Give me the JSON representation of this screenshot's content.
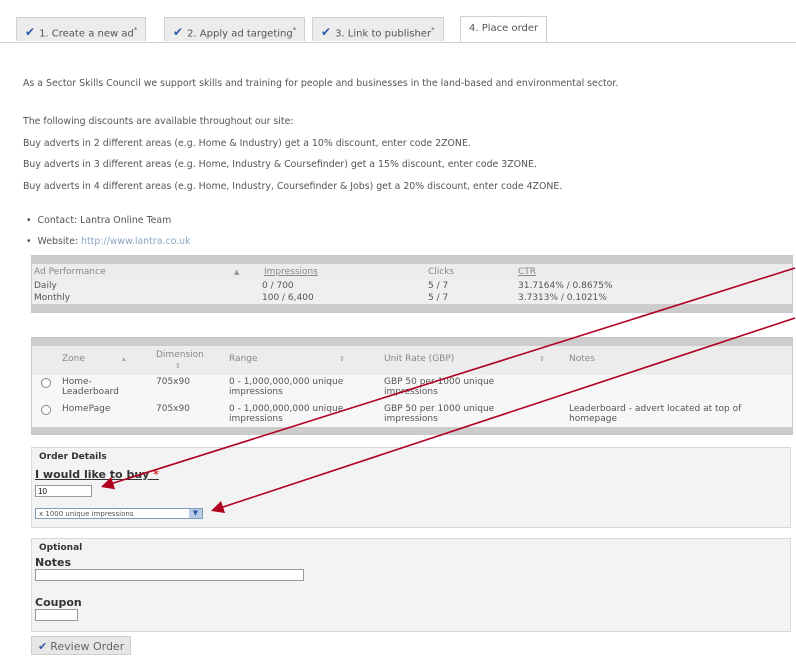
{
  "tabs": [
    {
      "label": "1. Create a new ad",
      "mark": "*",
      "done": true
    },
    {
      "label": "2. Apply ad targeting",
      "mark": "*",
      "done": true
    },
    {
      "label": "3. Link to publisher",
      "mark": "*",
      "done": true
    },
    {
      "label": "4. Place order",
      "mark": "",
      "done": false
    }
  ],
  "intro": "As a Sector Skills Council we support skills and training for people and businesses in the land-based and environmental sector.",
  "discounts": {
    "heading": "The following discounts are available throughout our site:",
    "lines": [
      "Buy adverts in 2 different areas (e.g. Home & Industry) get a 10% discount, enter code 2ZONE.",
      "Buy adverts in 3 different areas (e.g. Home, Industry & Coursefinder) get a 15% discount, enter code 3ZONE.",
      "Buy adverts in 4 different areas (e.g. Home, Industry, Coursefinder & Jobs) get a 20% discount, enter code 4ZONE."
    ]
  },
  "contact": {
    "contact_label": "Contact: Lantra Online Team",
    "website_label": "Website:",
    "website_url": "http://www.lantra.co.uk"
  },
  "performance": {
    "headers": [
      "Ad Performance",
      "Impressions",
      "Clicks",
      "CTR"
    ],
    "rows": [
      [
        "Daily",
        "0 / 700",
        "5 / 7",
        "31.7164% / 0.8675%"
      ],
      [
        "Monthly",
        "100 / 6,400",
        "5 / 7",
        "3.7313% / 0.1021%"
      ]
    ]
  },
  "zones": {
    "headers": [
      "Zone",
      "Dimension",
      "Range",
      "Unit Rate (GBP)",
      "Notes"
    ],
    "rows": [
      {
        "zone": "Home-Leaderboard",
        "dimension": "705x90",
        "range": "0 - 1,000,000,000 unique impressions",
        "rate": "GBP 50 per 1000 unique impressions",
        "notes": ""
      },
      {
        "zone": "HomePage",
        "dimension": "705x90",
        "range": "0 - 1,000,000,000 unique impressions",
        "rate": "GBP 50 per 1000 unique impressions",
        "notes": "Leaderboard - advert located at top of homepage"
      }
    ]
  },
  "order": {
    "title": "Order Details",
    "buy_label": "I would like to buy",
    "required_mark": "*",
    "quantity_value": "10",
    "unit_selected": "x 1000 unique impressions"
  },
  "optional": {
    "title": "Optional",
    "notes_label": "Notes",
    "notes_value": "",
    "coupon_label": "Coupon",
    "coupon_value": ""
  },
  "review_button": "Review Order",
  "colors": {
    "accent": "#2d5aa8",
    "annotation": "#b00020",
    "required": "#cc3333"
  }
}
